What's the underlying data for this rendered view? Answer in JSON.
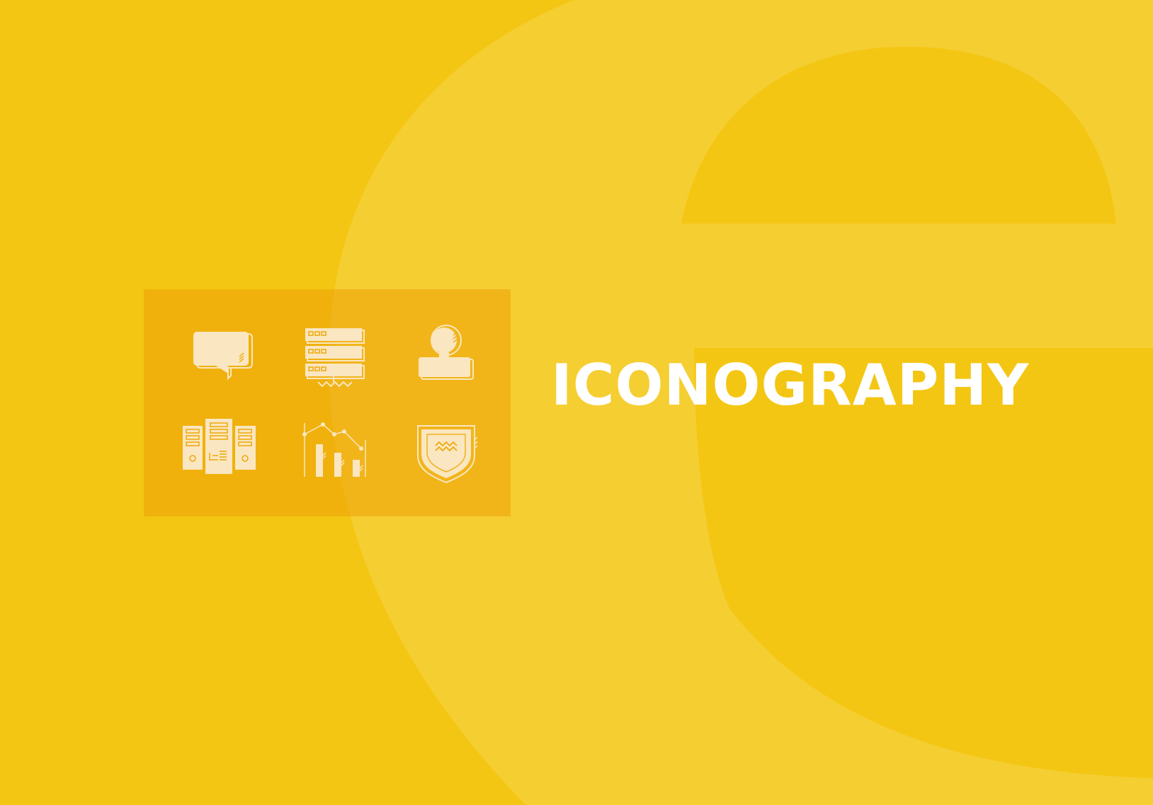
{
  "title": "ICONOGRAPHY",
  "colors": {
    "background": "#F4C614",
    "letter_light": "#F5CE32",
    "panel": "#EEA808",
    "icon_fill": "#FAE6C0",
    "title": "#FFFFFF"
  },
  "icons": [
    "speech-bubble-icon",
    "server-rack-icon",
    "user-profile-icon",
    "computer-towers-icon",
    "bar-chart-icon",
    "shield-icon"
  ]
}
